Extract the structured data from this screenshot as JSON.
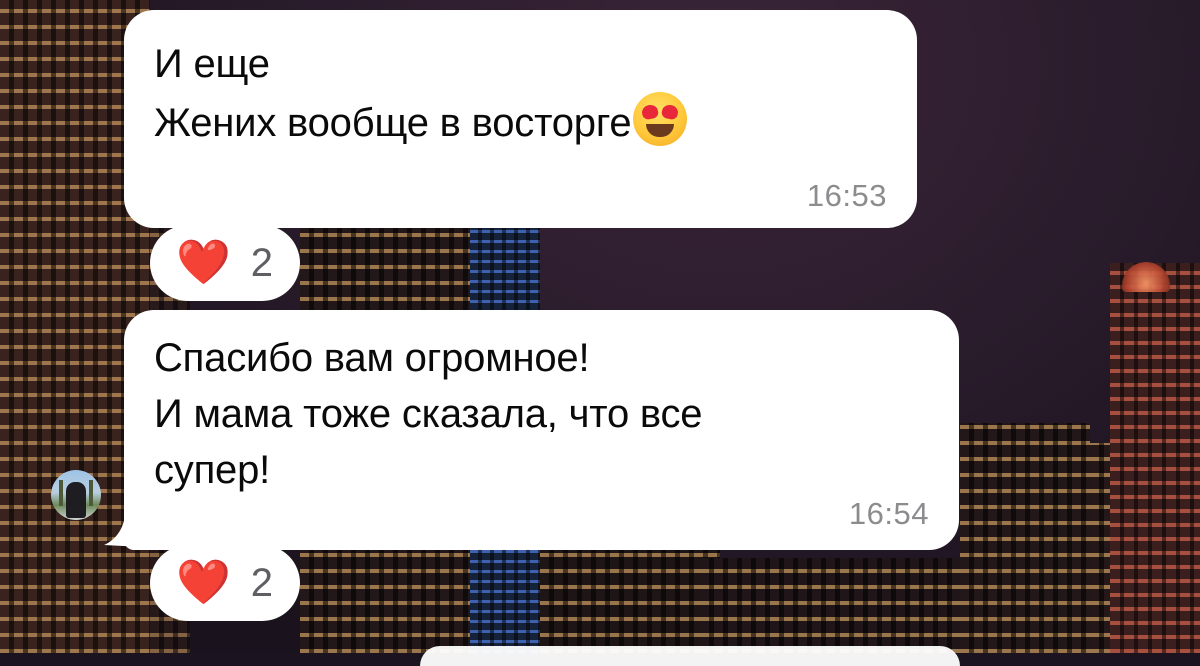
{
  "messages": [
    {
      "lines": [
        "И еще",
        "Жених вообще в восторге"
      ],
      "emoji": "smiling-face-with-heart-eyes",
      "time": "16:53",
      "reaction": {
        "emoji": "❤️",
        "count": "2"
      }
    },
    {
      "lines": [
        "Спасибо вам огромное!",
        "И мама тоже сказала, что все",
        "супер!"
      ],
      "time": "16:54",
      "reaction": {
        "emoji": "❤️",
        "count": "2"
      }
    }
  ],
  "colors": {
    "bubble": "#ffffff",
    "text": "#0a0a0a",
    "time": "#8c8c8f",
    "heart": "#e9152b"
  }
}
